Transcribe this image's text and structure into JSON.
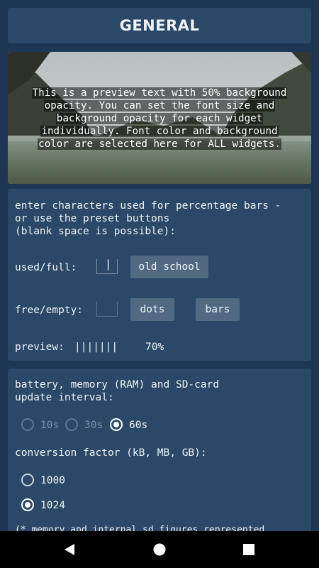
{
  "header": {
    "title": "GENERAL"
  },
  "preview": {
    "lines": [
      "This is a preview text with 50% background",
      "opacity. You can set the font size and",
      "background opacity for each widget",
      "individually. Font color and background",
      "color are selected here for ALL widgets."
    ]
  },
  "bars": {
    "intro": "enter characters used for percentage bars -\nor use the preset buttons\n(blank space is possible):",
    "used_label": "used/full:",
    "used_value": "|",
    "old_school_label": "old school",
    "free_label": "free/empty:",
    "free_value": "",
    "dots_label": "dots",
    "bars_label": "bars",
    "preview_label": "preview:",
    "preview_bar": "|||||||",
    "preview_percent": "70%"
  },
  "update": {
    "intro": "battery, memory (RAM) and SD-card\nupdate interval:",
    "options": [
      "10s",
      "30s",
      "60s"
    ],
    "selected": "60s"
  },
  "conversion": {
    "label": "conversion factor (kB, MB, GB):",
    "options": [
      "1000",
      "1024"
    ],
    "selected": "1024"
  },
  "footnote": "(* memory and internal sd figures represented",
  "colors": {
    "background": "#1d3653",
    "card": "#2b4868",
    "button": "#516a82"
  },
  "navbar": {
    "icons": [
      "back-icon",
      "home-icon",
      "recents-icon"
    ]
  }
}
